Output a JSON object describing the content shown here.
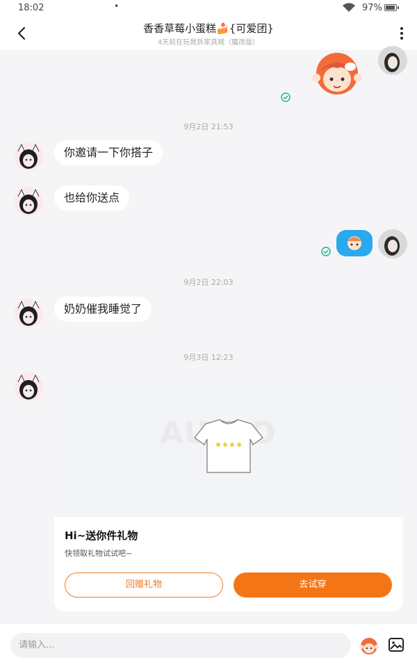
{
  "status_bar": {
    "time": "18:02",
    "dot": "•",
    "battery": "97%",
    "battery_level": 0.97
  },
  "header": {
    "title": "香香草莓小蛋糕🍰{可爱团}",
    "subtitle": "4天前在玩我拆家具贼（魔改版）"
  },
  "messages": [
    {
      "timestamp": "9月2日 21:53"
    },
    {
      "text": "你邀请一下你搭子"
    },
    {
      "text": "也给你送点"
    },
    {
      "timestamp": "9月2日 22:03"
    },
    {
      "text": "奶奶催我睡觉了"
    },
    {
      "timestamp": "9月3日 12:23"
    }
  ],
  "gift_card": {
    "watermark": "AUDIO",
    "title": "Hi~送你件礼物",
    "subtitle": "快领取礼物试试吧~",
    "return_button": "回赠礼物",
    "try_button": "去试穿"
  },
  "input": {
    "placeholder": "请输入..."
  },
  "colors": {
    "accent": "#f47516",
    "check": "#1bb98a",
    "emoji_bubble": "#29a9ef"
  },
  "icons": [
    "back-arrow-icon",
    "more-vertical-icon",
    "read-check-icon",
    "sticker-icon",
    "image-icon"
  ]
}
